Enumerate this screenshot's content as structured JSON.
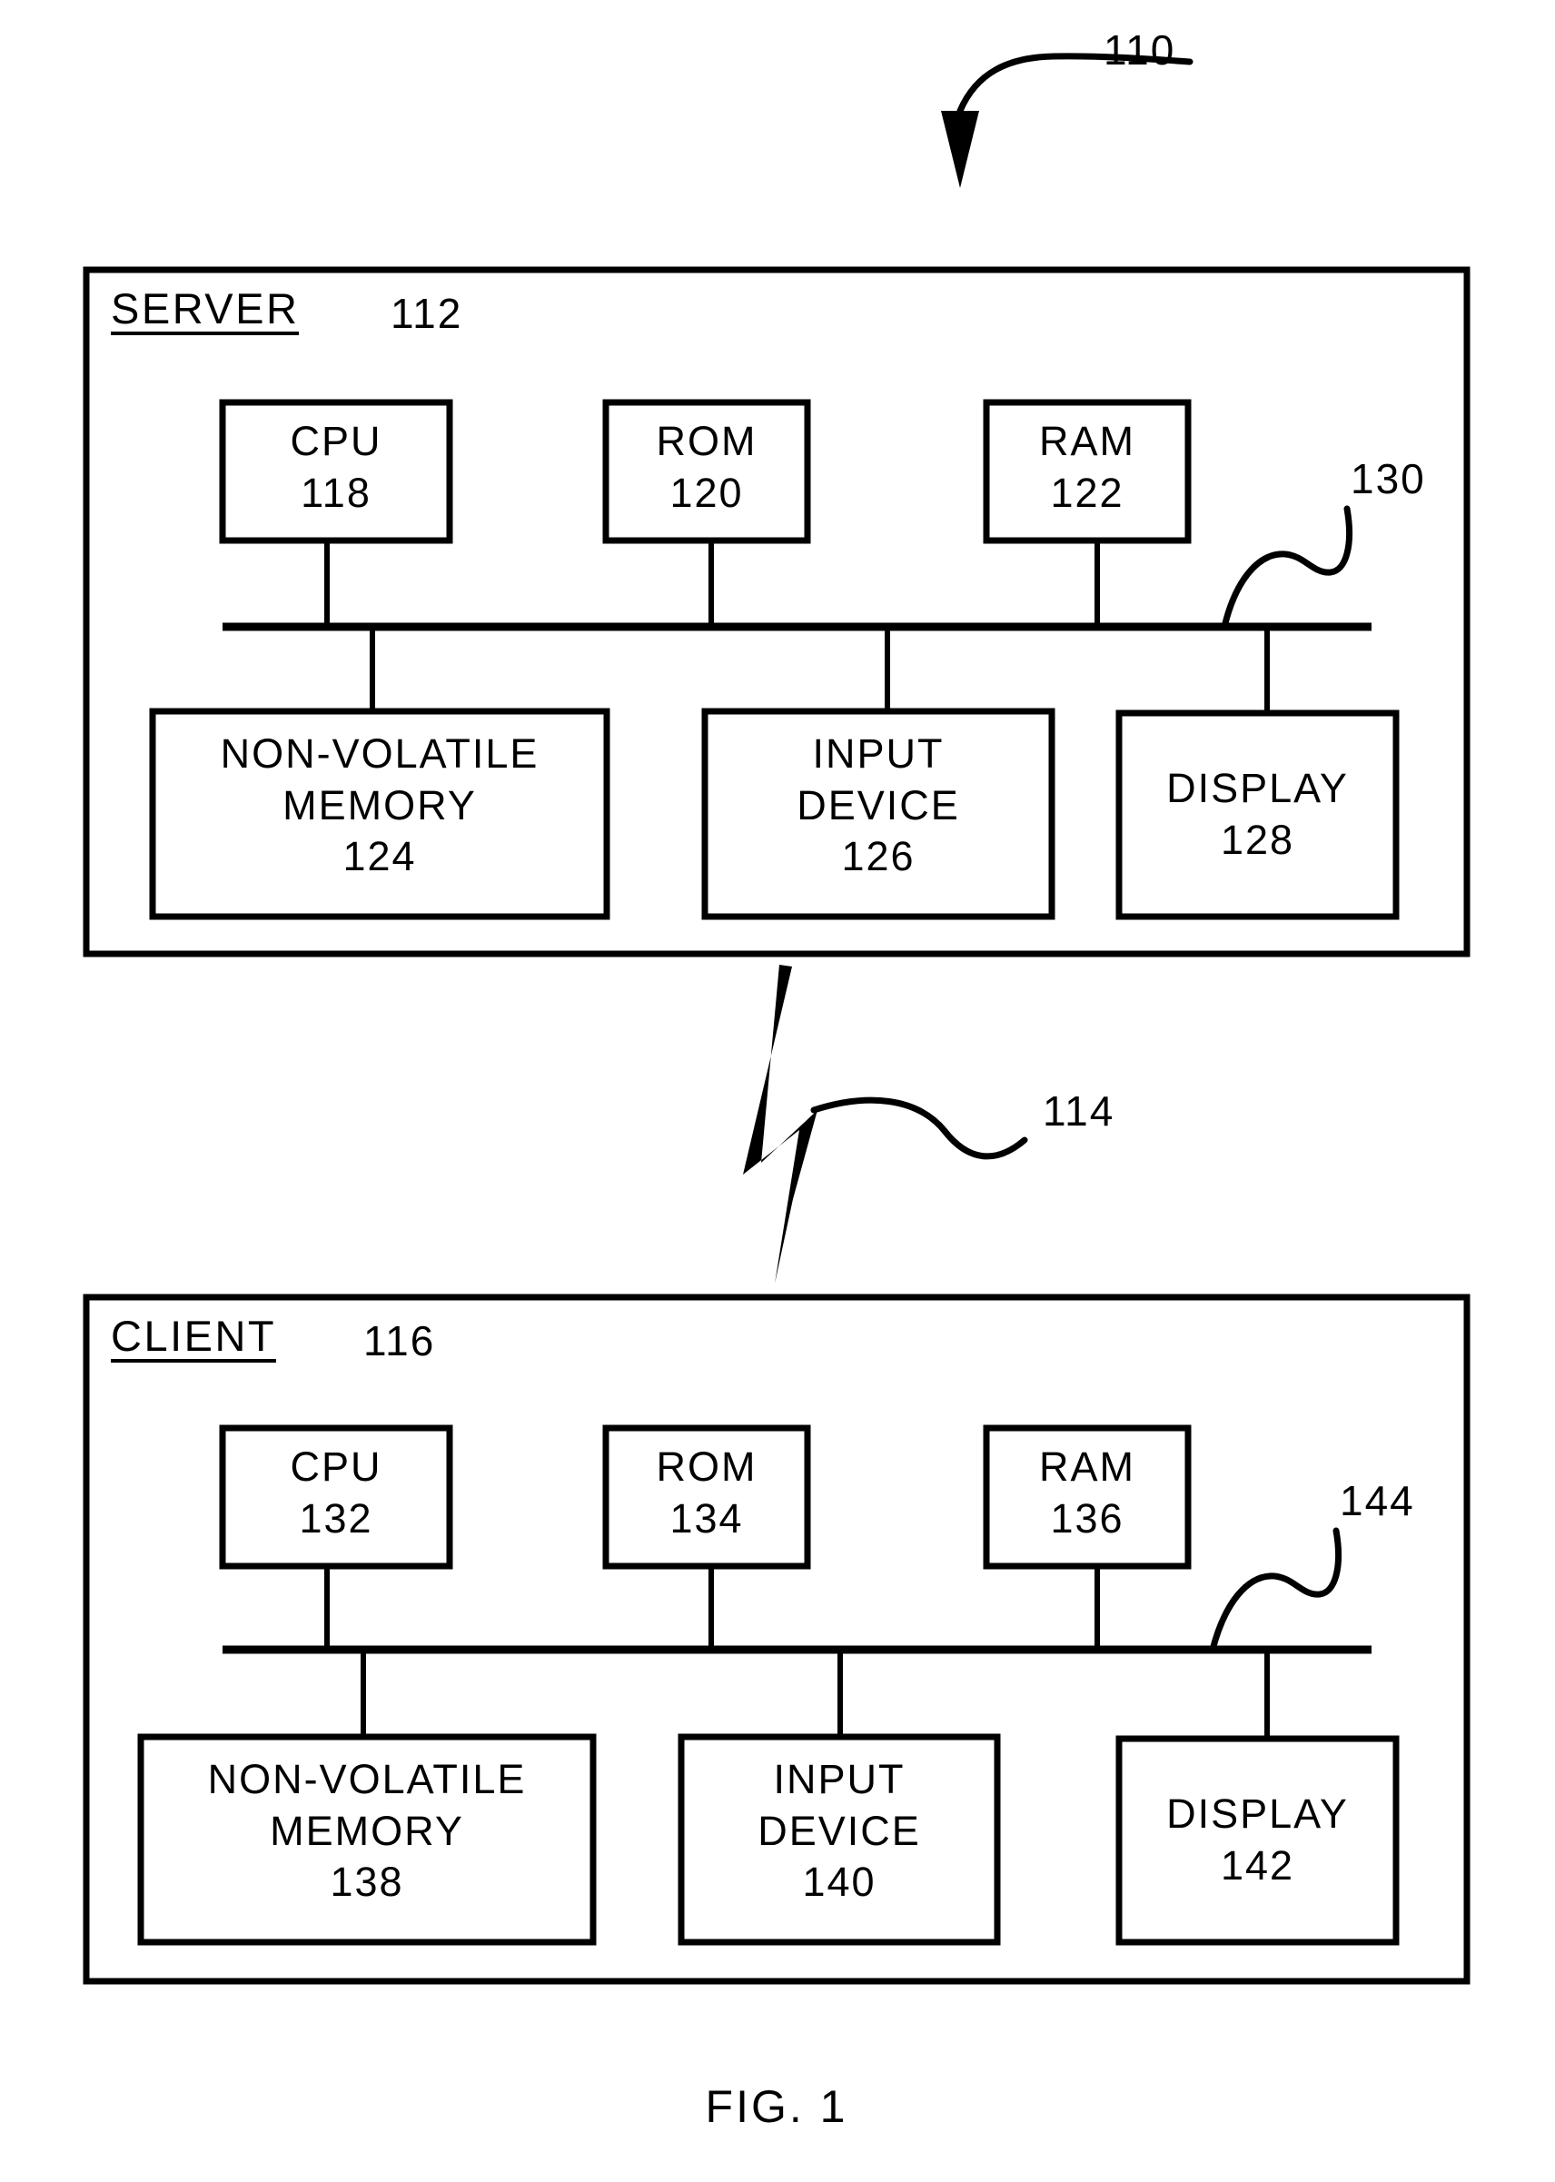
{
  "figure": {
    "caption": "FIG. 1",
    "system_ref": "110",
    "link_ref": "114"
  },
  "panels": [
    {
      "id": "server",
      "title": "SERVER",
      "ref": "112",
      "bus_ref": "130",
      "top_row": [
        {
          "name": "CPU",
          "ref": "118"
        },
        {
          "name": "ROM",
          "ref": "120"
        },
        {
          "name": "RAM",
          "ref": "122"
        }
      ],
      "bottom_row": [
        {
          "line1": "NON-VOLATILE",
          "line2": "MEMORY",
          "ref": "124"
        },
        {
          "line1": "INPUT",
          "line2": "DEVICE",
          "ref": "126"
        },
        {
          "line1": "DISPLAY",
          "line2": "",
          "ref": "128"
        }
      ]
    },
    {
      "id": "client",
      "title": "CLIENT",
      "ref": "116",
      "bus_ref": "144",
      "top_row": [
        {
          "name": "CPU",
          "ref": "132"
        },
        {
          "name": "ROM",
          "ref": "134"
        },
        {
          "name": "RAM",
          "ref": "136"
        }
      ],
      "bottom_row": [
        {
          "line1": "NON-VOLATILE",
          "line2": "MEMORY",
          "ref": "138"
        },
        {
          "line1": "INPUT",
          "line2": "DEVICE",
          "ref": "140"
        },
        {
          "line1": "DISPLAY",
          "line2": "",
          "ref": "142"
        }
      ]
    }
  ],
  "colors": {
    "ink": "#000000",
    "paper": "#ffffff"
  }
}
